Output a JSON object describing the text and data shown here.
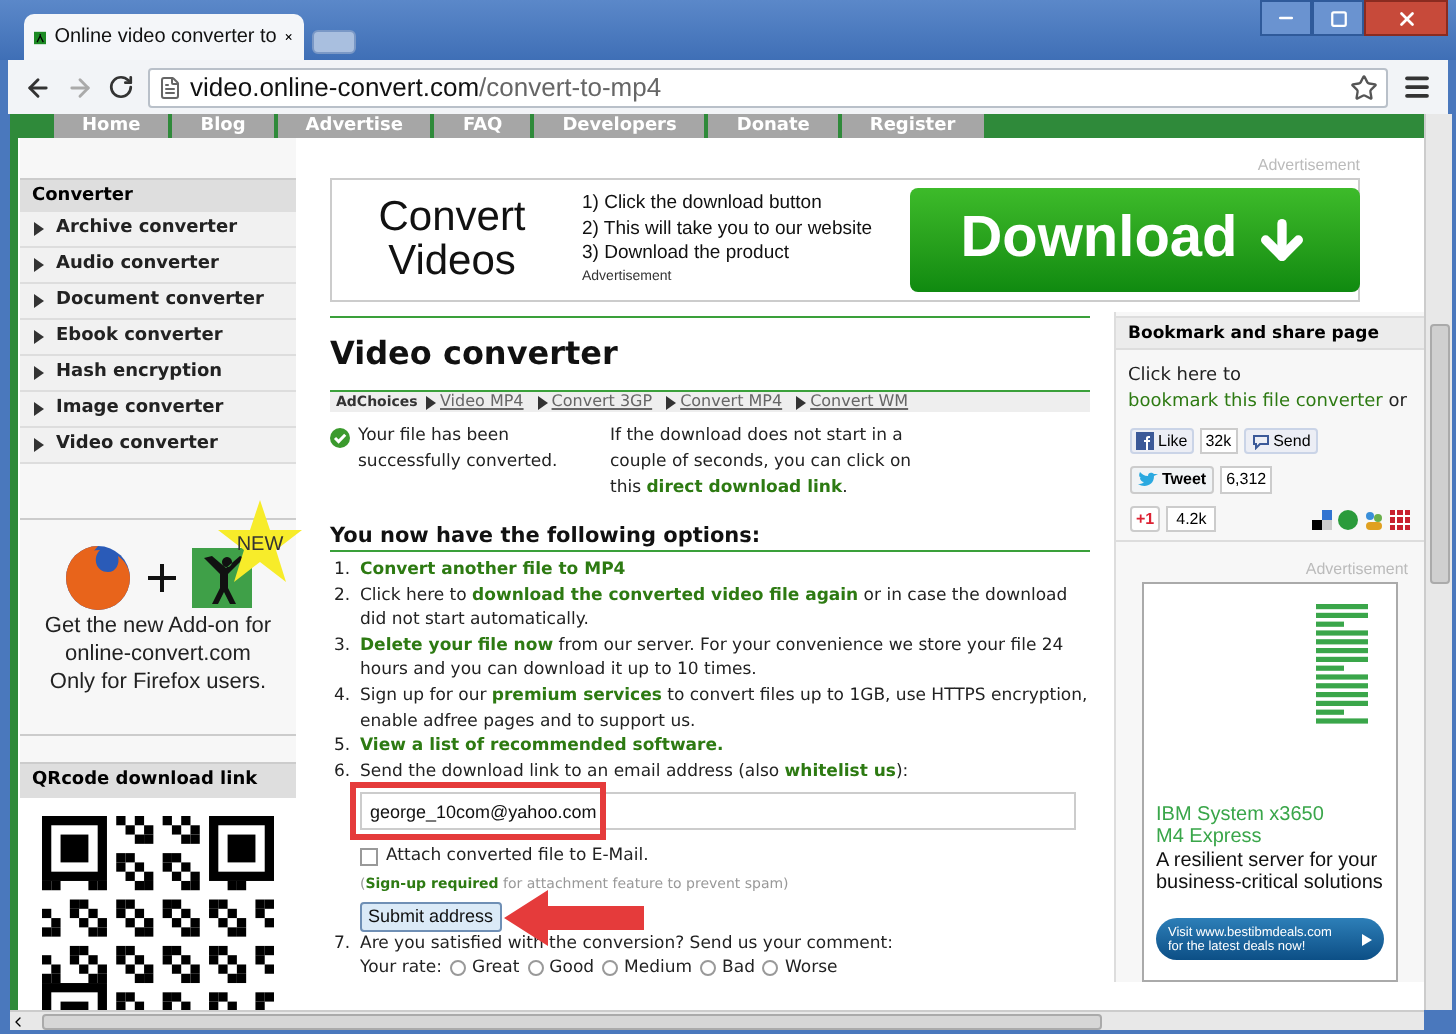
{
  "browser": {
    "tab_title": "Online video converter to",
    "url_host": "video.online-convert.com",
    "url_path": "/convert-to-mp4"
  },
  "nav_tabs": [
    "Home",
    "Blog",
    "Advertise",
    "FAQ",
    "Developers",
    "Donate",
    "Register"
  ],
  "sidebar": {
    "heading": "Converter",
    "items": [
      "Archive converter",
      "Audio converter",
      "Document converter",
      "Ebook converter",
      "Hash encryption",
      "Image converter",
      "Video converter"
    ],
    "addon": {
      "badge": "NEW",
      "lines": [
        "Get the new Add-on for",
        "online-convert.com",
        "Only for Firefox users."
      ]
    },
    "qr_heading": "QRcode download link"
  },
  "banner_ad": {
    "label": "Advertisement",
    "title_lines": [
      "Convert",
      "Videos"
    ],
    "steps": [
      "1) Click the download button",
      "2) This will take you to our website",
      "3) Download the product"
    ],
    "sublabel": "Advertisement",
    "button": "Download"
  },
  "main": {
    "title": "Video converter",
    "adchoices": "AdChoices",
    "ad_links": [
      "Video MP4",
      "Convert 3GP",
      "Convert MP4",
      "Convert WM"
    ],
    "success": "Your file has been successfully converted.",
    "direct_note": [
      {
        "kind": "text",
        "text": "If the download does not start in a couple of seconds, you can click on this "
      },
      {
        "kind": "link",
        "text": "direct download link"
      },
      {
        "kind": "text",
        "text": "."
      }
    ],
    "options_heading": "You now have the following options:",
    "options": [
      {
        "kind": "text",
        "number": "1.",
        "segments": [
          {
            "kind": "link",
            "text": "Convert another file to MP4"
          }
        ]
      },
      {
        "kind": "text",
        "number": "2.",
        "segments": [
          {
            "kind": "text",
            "text": "Click here to "
          },
          {
            "kind": "link",
            "text": "download the converted video file again"
          },
          {
            "kind": "text",
            "text": " or in case the download did not start automatically."
          }
        ]
      },
      {
        "kind": "text",
        "number": "3.",
        "segments": [
          {
            "kind": "link",
            "text": "Delete your file now"
          },
          {
            "kind": "text",
            "text": " from our server. For your convenience we store your file 24 hours and you can download it up to 10 times."
          }
        ]
      },
      {
        "kind": "text",
        "number": "4.",
        "segments": [
          {
            "kind": "text",
            "text": "Sign up for our "
          },
          {
            "kind": "link",
            "text": "premium services"
          },
          {
            "kind": "text",
            "text": " to convert files up to 1GB, use HTTPS encryption, enable adfree pages and to support us."
          }
        ]
      },
      {
        "kind": "text",
        "number": "5.",
        "segments": [
          {
            "kind": "link",
            "text": "View a list of recommended software."
          }
        ]
      },
      {
        "kind": "email",
        "number": "6.",
        "segments": [
          {
            "kind": "text",
            "text": "Send the download link to an email address (also "
          },
          {
            "kind": "link",
            "text": "whitelist us"
          },
          {
            "kind": "text",
            "text": "):"
          }
        ],
        "field": {
          "value": "george_10com@yahoo.com"
        },
        "checkbox": {
          "label": "Attach converted file to E-Mail.",
          "checked": false
        },
        "note": [
          {
            "kind": "text",
            "text": "("
          },
          {
            "kind": "link",
            "text": "Sign-up required"
          },
          {
            "kind": "text",
            "text": " for attachment feature to prevent spam)"
          }
        ],
        "button": "Submit address"
      },
      {
        "kind": "rating",
        "number": "7.",
        "segments": [
          {
            "kind": "text",
            "text": "Are you satisfied with the conversion? Send us your comment:"
          }
        ],
        "rating": {
          "label": "Your rate:",
          "options": [
            {
              "label": "Great",
              "selected": false
            },
            {
              "label": "Good",
              "selected": false
            },
            {
              "label": "Medium",
              "selected": false
            },
            {
              "label": "Bad",
              "selected": false
            },
            {
              "label": "Worse",
              "selected": false
            }
          ]
        }
      }
    ]
  },
  "share": {
    "heading": "Bookmark and share page",
    "text": [
      {
        "kind": "text",
        "text": "Click here to "
      },
      {
        "kind": "link",
        "text": "bookmark this file converter"
      },
      {
        "kind": "text",
        "text": " or"
      }
    ],
    "like": "Like",
    "like_count": "32k",
    "send": "Send",
    "tweet": "Tweet",
    "tweet_count": "6,312",
    "plus": "+1",
    "plus_count": "4.2k"
  },
  "side_ad": {
    "label": "Advertisement",
    "headline_lines": [
      "IBM System x3650",
      "M4 Express"
    ],
    "body": "A resilient server for your business-critical solutions",
    "button_lines": [
      "Visit www.bestibmdeals.com",
      "for the latest deals now!"
    ]
  }
}
